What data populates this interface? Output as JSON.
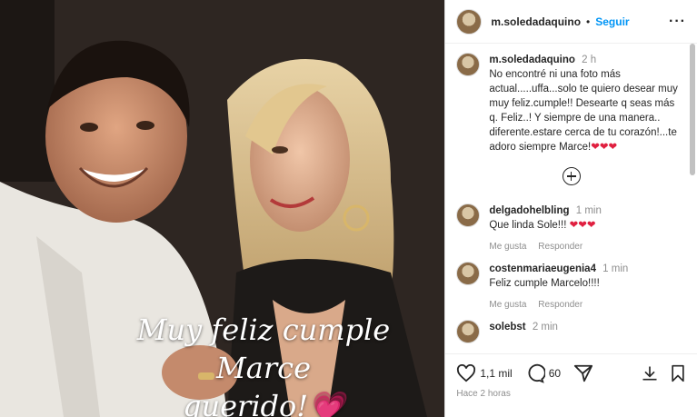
{
  "post": {
    "caption_line1": "Muy feliz cumple Marce",
    "caption_line2": "querido!",
    "caption_heart": "💗"
  },
  "header": {
    "username": "m.soledadaquino",
    "separator": "•",
    "follow_label": "Seguir",
    "more_label": "···"
  },
  "main_comment": {
    "username": "m.soledadaquino",
    "time": "2 h",
    "text": "No encontré ni una foto más actual.....uffa...solo te quiero desear muy muy feliz.cumple!! Desearte q seas más q. Feliz..! Y siempre de una manera.. diferente.estare cerca de tu corazón!...te adoro siempre Marce!",
    "hearts": "❤❤❤"
  },
  "comments": [
    {
      "username": "delgadohelbling",
      "time": "1 min",
      "text": "Que linda Sole!!!",
      "hearts": "❤❤❤",
      "like_label": "Me gusta",
      "reply_label": "Responder"
    },
    {
      "username": "costenmariaeugenia4",
      "time": "1 min",
      "text": "Feliz cumple Marcelo!!!!",
      "hearts": "",
      "like_label": "Me gusta",
      "reply_label": "Responder"
    },
    {
      "username": "solebst",
      "time": "2 min",
      "text": "",
      "hearts": "",
      "like_label": "",
      "reply_label": ""
    }
  ],
  "actions": {
    "likes": "1,1 mil",
    "comments": "60",
    "posted_ago": "Hace 2 horas"
  },
  "icons": [
    "heart-icon",
    "comment-icon",
    "share-icon",
    "download-icon",
    "bookmark-icon",
    "add-circle-icon",
    "more-icon"
  ]
}
